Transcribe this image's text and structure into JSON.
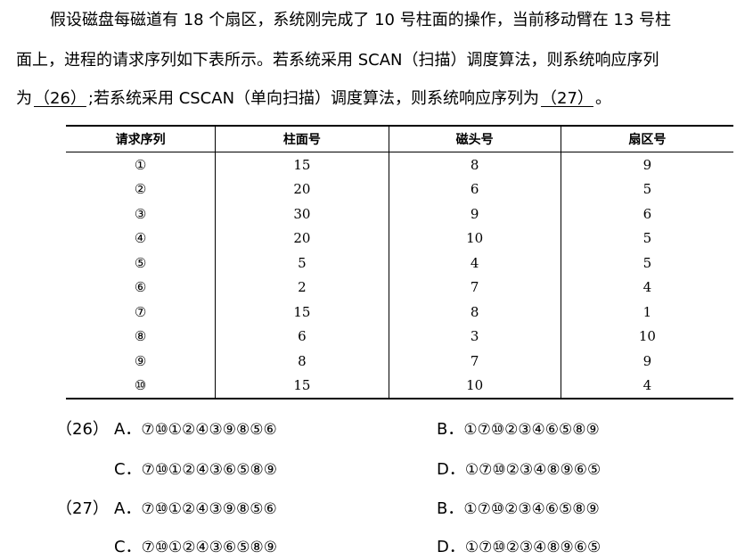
{
  "question": {
    "line1": "假设磁盘每磁道有 18 个扇区，系统刚完成了 10 号柱面的操作，当前移动臂在 13 号柱",
    "line2": "面上，进程的请求序列如下表所示。若系统采用 SCAN（扫描）调度算法，则系统响应序列",
    "line3_pre": "为",
    "blank26": "（26）",
    "line3_mid": ";若系统采用 CSCAN（单向扫描）调度算法，则系统响应序列为",
    "blank27": "（27）",
    "line3_post": "。"
  },
  "table": {
    "headers": [
      "请求序列",
      "柱面号",
      "磁头号",
      "扇区号"
    ],
    "rows": [
      [
        "①",
        "15",
        "8",
        "9"
      ],
      [
        "②",
        "20",
        "6",
        "5"
      ],
      [
        "③",
        "30",
        "9",
        "6"
      ],
      [
        "④",
        "20",
        "10",
        "5"
      ],
      [
        "⑤",
        "5",
        "4",
        "5"
      ],
      [
        "⑥",
        "2",
        "7",
        "4"
      ],
      [
        "⑦",
        "15",
        "8",
        "1"
      ],
      [
        "⑧",
        "6",
        "3",
        "10"
      ],
      [
        "⑨",
        "8",
        "7",
        "9"
      ],
      [
        "⑩",
        "15",
        "10",
        "4"
      ]
    ]
  },
  "options": [
    {
      "number": "（26）",
      "A_label": "A．",
      "A": "⑦⑩①②④③⑨⑧⑤⑥",
      "B_label": "B．",
      "B": "①⑦⑩②③④⑥⑤⑧⑨",
      "C_label": "C．",
      "C": "⑦⑩①②④③⑥⑤⑧⑨",
      "D_label": "D．",
      "D": "①⑦⑩②③④⑧⑨⑥⑤"
    },
    {
      "number": "（27）",
      "A_label": "A．",
      "A": "⑦⑩①②④③⑨⑧⑤⑥",
      "B_label": "B．",
      "B": "①⑦⑩②③④⑥⑤⑧⑨",
      "C_label": "C．",
      "C": "⑦⑩①②④③⑥⑤⑧⑨",
      "D_label": "D．",
      "D": "①⑦⑩②③④⑧⑨⑥⑤"
    }
  ]
}
